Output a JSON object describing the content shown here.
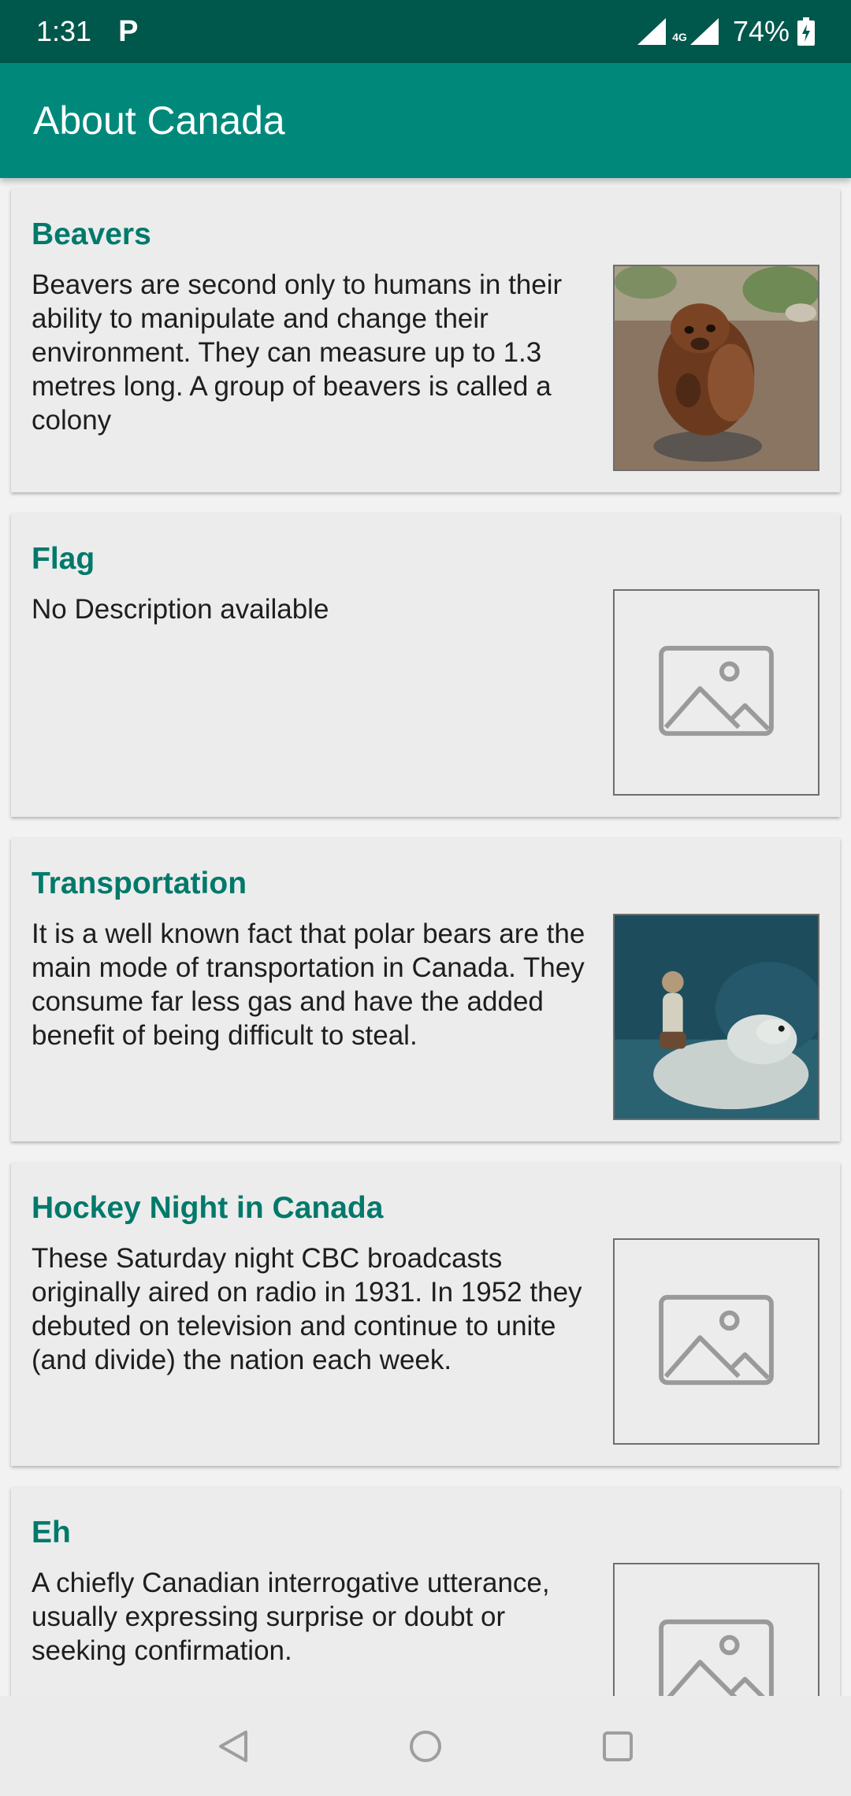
{
  "status_bar": {
    "time": "1:31",
    "notification_icon": "P",
    "network": "4G",
    "battery": "74%"
  },
  "app_bar": {
    "title": "About Canada"
  },
  "cards": [
    {
      "title": "Beavers",
      "description": "Beavers are second only to humans in their ability to manipulate and change their environment. They can measure up to 1.3 metres long. A group of beavers is called a colony",
      "image": "beaver-photo"
    },
    {
      "title": "Flag",
      "description": "No Description available",
      "image": "placeholder-image-icon"
    },
    {
      "title": "Transportation",
      "description": "It is a well known fact that polar bears are the main mode of transportation in Canada. They consume far less gas and have the added benefit of being difficult to steal.",
      "image": "polar-bear-photo"
    },
    {
      "title": "Hockey Night in Canada",
      "description": "These Saturday night CBC broadcasts originally aired on radio in 1931. In 1952 they debuted on television and continue to unite (and divide) the nation each week.",
      "image": "placeholder-image-icon"
    },
    {
      "title": "Eh",
      "description": "A chiefly Canadian interrogative utterance, usually expressing surprise or doubt or seeking confirmation.",
      "image": "placeholder-image-icon"
    }
  ],
  "nav_bar": {
    "back_icon": "back-triangle-icon",
    "home_icon": "home-circle-icon",
    "recents_icon": "recents-square-icon"
  }
}
